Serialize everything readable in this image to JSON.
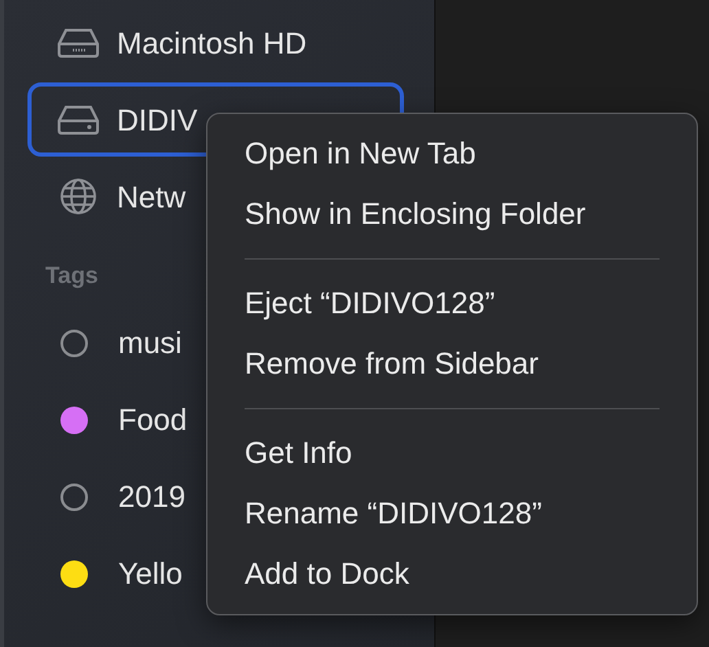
{
  "sidebar": {
    "locations": [
      {
        "label": "Macintosh HD",
        "kind": "internal-drive",
        "selected": false
      },
      {
        "label": "DIDIV",
        "kind": "external-drive",
        "selected": true
      },
      {
        "label": "Netw",
        "kind": "network",
        "selected": false
      }
    ],
    "tags_header": "Tags",
    "tags": [
      {
        "label": "musi"
      },
      {
        "label": "Food",
        "color": "#d66ff5"
      },
      {
        "label": "2019"
      },
      {
        "label": "Yello",
        "color": "#fddd13"
      }
    ]
  },
  "context_menu": {
    "groups": [
      [
        "Open in New Tab",
        "Show in Enclosing Folder"
      ],
      [
        "Eject “DIDIVO128”",
        "Remove from Sidebar"
      ],
      [
        "Get Info",
        "Rename “DIDIVO128”",
        "Add to Dock"
      ]
    ]
  }
}
